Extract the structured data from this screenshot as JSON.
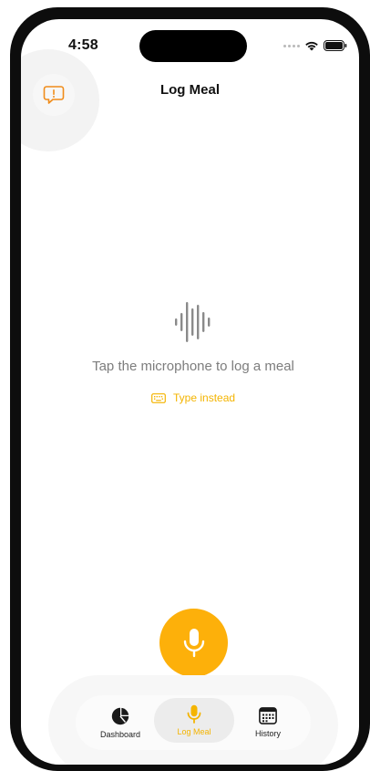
{
  "status_bar": {
    "time": "4:58"
  },
  "header": {
    "title": "Log Meal",
    "feedback_icon": "feedback-message-icon"
  },
  "main": {
    "waveform_icon": "waveform-icon",
    "prompt": "Tap the microphone to log a meal",
    "type_instead_label": "Type instead",
    "type_instead_icon": "keyboard-icon"
  },
  "mic_button": {
    "icon": "microphone-icon",
    "color": "#FDB00A"
  },
  "tab_bar": {
    "tabs": [
      {
        "label": "Dashboard",
        "icon": "pie-chart-icon",
        "selected": false
      },
      {
        "label": "Log Meal",
        "icon": "microphone-icon",
        "selected": true
      },
      {
        "label": "History",
        "icon": "calendar-icon",
        "selected": false
      }
    ]
  },
  "colors": {
    "accent": "#F4B400",
    "text_primary": "#111111",
    "text_secondary": "#7D7D7D"
  }
}
